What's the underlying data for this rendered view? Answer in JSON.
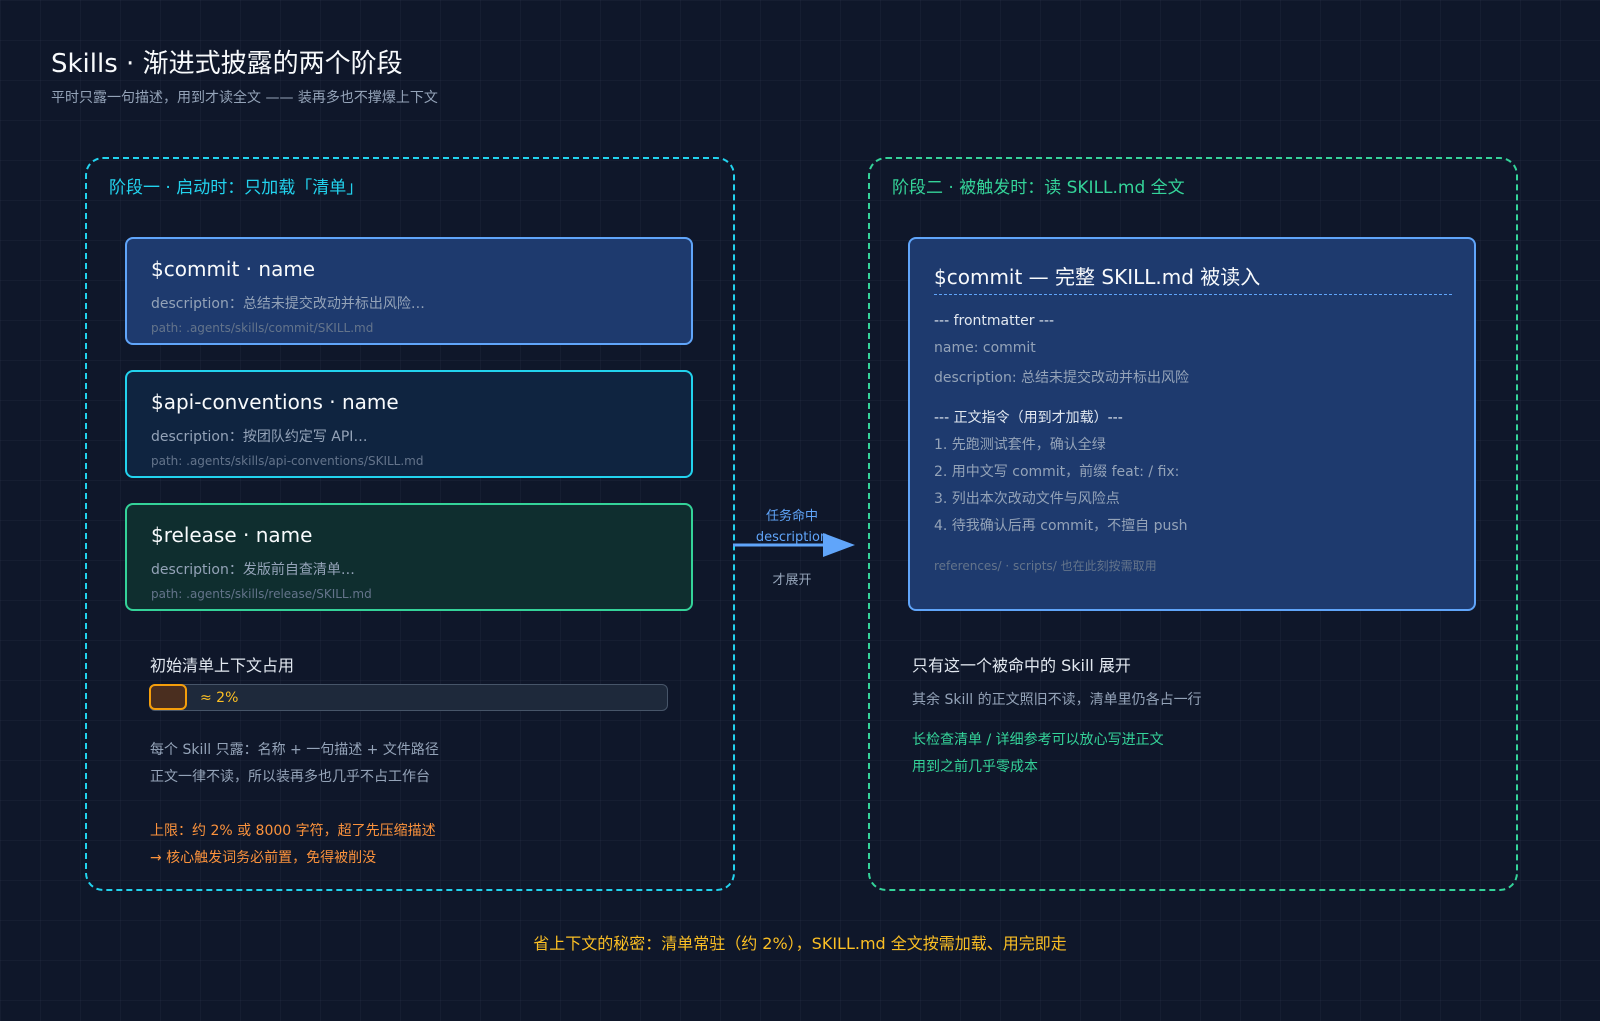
{
  "title": "Skills · 渐进式披露的两个阶段",
  "subtitle": "平时只露一句描述，用到才读全文 —— 装再多也不撑爆上下文",
  "stage1": {
    "heading": "阶段一 · 启动时：只加载「清单」",
    "cards": [
      {
        "name": "$commit · name",
        "description": "description：总结未提交改动并标出风险…",
        "path": "path: .agents/skills/commit/SKILL.md"
      },
      {
        "name": "$api-conventions · name",
        "description": "description：按团队约定写 API…",
        "path": "path: .agents/skills/api-conventions/SKILL.md"
      },
      {
        "name": "$release · name",
        "description": "description：发版前自查清单…",
        "path": "path: .agents/skills/release/SKILL.md"
      }
    ],
    "usage_label": "初始清单上下文占用",
    "usage_value": "≈ 2%",
    "usage_fraction": 0.02,
    "notes": [
      "每个 Skill 只露：名称 + 一句描述 + 文件路径",
      "正文一律不读，所以装再多也几乎不占工作台"
    ],
    "limits": [
      "上限：约 2% 或 8000 字符，超了先压缩描述",
      "→ 核心触发词务必前置，免得被削没"
    ]
  },
  "arrow": {
    "top_lines": [
      "任务命中",
      "description"
    ],
    "bottom": "才展开"
  },
  "stage2": {
    "heading": "阶段二 · 被触发时：读 SKILL.md 全文",
    "card_title": "$commit — 完整 SKILL.md 被读入",
    "frontmatter_label": "--- frontmatter ---",
    "frontmatter_lines": [
      "name: commit",
      "description: 总结未提交改动并标出风险"
    ],
    "body_label": "--- 正文指令（用到才加载）---",
    "steps": [
      "1. 先跑测试套件，确认全绿",
      "2. 用中文写 commit，前缀 feat: / fix:",
      "3. 列出本次改动文件与风险点",
      "4. 待我确认后再 commit，不擅自 push"
    ],
    "refs": "references/ · scripts/ 也在此刻按需取用",
    "note_title": "只有这一个被命中的 Skill 展开",
    "note_sub": "其余 Skill 的正文照旧不读，清单里仍各占一行",
    "green_notes": [
      "长检查清单 / 详细参考可以放心写进正文",
      "用到之前几乎零成本"
    ]
  },
  "footer": "省上下文的秘密：清单常驻（约 2%），SKILL.md 全文按需加载、用完即走",
  "colors": {
    "cyan": "#22d3ee",
    "green": "#34d399",
    "blue": "#60a5fa",
    "orange": "#fb923c",
    "amber": "#fbbf24"
  }
}
